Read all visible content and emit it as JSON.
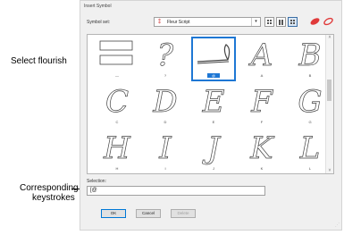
{
  "dialog": {
    "title": "Insert Symbol",
    "symbol_set_label": "Symbol set:",
    "symbol_set_value": "Fleur Script",
    "selection_label": "Selection:",
    "selection_value": "[@",
    "ok_label": "OK",
    "cancel_label": "Cancel",
    "delete_label": "Delete"
  },
  "annotations": {
    "select_flourish": "Select flourish",
    "corresponding_1": "Corresponding",
    "corresponding_2": "keystrokes"
  },
  "symbols": [
    {
      "glyph": "",
      "label": "—",
      "kind": "rect"
    },
    {
      "glyph": "?",
      "label": "?",
      "kind": "char"
    },
    {
      "glyph": "",
      "label": "@",
      "kind": "flourish",
      "selected": true
    },
    {
      "glyph": "A",
      "label": "A",
      "kind": "char"
    },
    {
      "glyph": "B",
      "label": "B",
      "kind": "char"
    },
    {
      "glyph": "C",
      "label": "C",
      "kind": "char"
    },
    {
      "glyph": "D",
      "label": "D",
      "kind": "char"
    },
    {
      "glyph": "E",
      "label": "E",
      "kind": "char"
    },
    {
      "glyph": "F",
      "label": "F",
      "kind": "char"
    },
    {
      "glyph": "G",
      "label": "G",
      "kind": "char"
    },
    {
      "glyph": "H",
      "label": "H",
      "kind": "char"
    },
    {
      "glyph": "I",
      "label": "I",
      "kind": "char"
    },
    {
      "glyph": "J",
      "label": "J",
      "kind": "char"
    },
    {
      "glyph": "K",
      "label": "K",
      "kind": "char"
    },
    {
      "glyph": "L",
      "label": "L",
      "kind": "char"
    }
  ],
  "colors": {
    "selection": "#1e77d4",
    "accent_red": "#d03030"
  }
}
